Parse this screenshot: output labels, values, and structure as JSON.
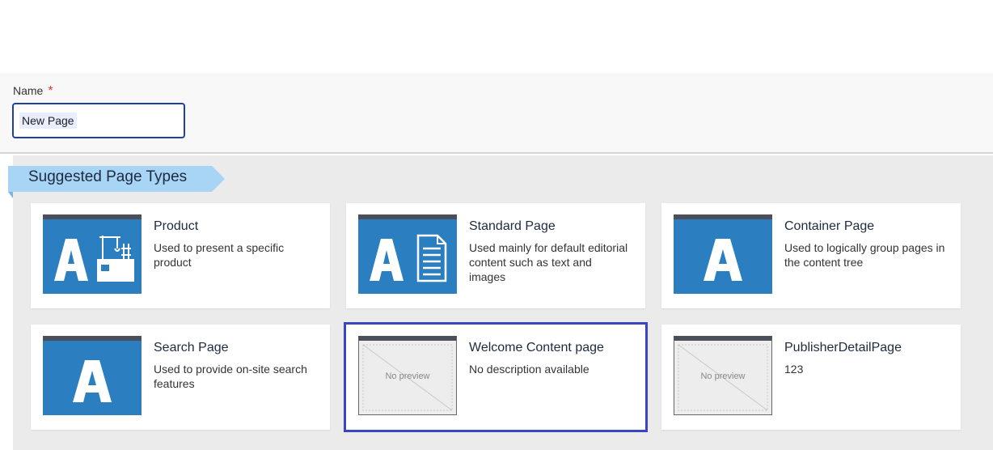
{
  "form": {
    "name_label": "Name",
    "required_mark": "*",
    "name_value": "New Page"
  },
  "section": {
    "title": "Suggested Page Types"
  },
  "page_types": [
    {
      "title": "Product",
      "description": "Used to present a specific product",
      "thumbnail": "product-icon"
    },
    {
      "title": "Standard Page",
      "description": "Used mainly for default editorial content such as text and images",
      "thumbnail": "document-icon"
    },
    {
      "title": "Container Page",
      "description": "Used to logically group pages in the content tree",
      "thumbnail": "letter-a-icon"
    },
    {
      "title": "Search Page",
      "description": "Used to provide on-site search features",
      "thumbnail": "letter-a-icon"
    },
    {
      "title": "Welcome Content page",
      "description": "No description available",
      "thumbnail": "no-preview",
      "preview_text": "No preview"
    },
    {
      "title": "PublisherDetailPage",
      "description": "123",
      "thumbnail": "no-preview",
      "preview_text": "No preview"
    }
  ],
  "colors": {
    "accent": "#1f3ea8",
    "selection": "#3a45c4",
    "banner": "#a8d4f5",
    "thumbnail": "#2b7fc1"
  }
}
